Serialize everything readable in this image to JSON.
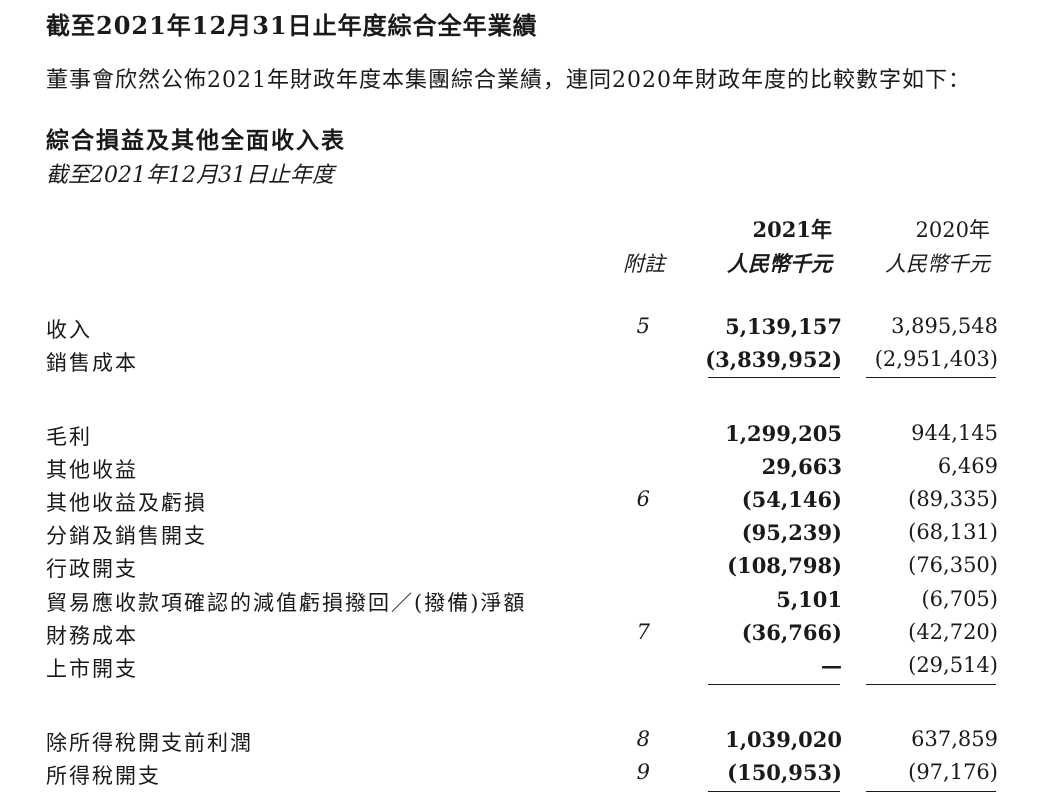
{
  "heading": "截至2021年12月31日止年度綜合全年業績",
  "intro": "董事會欣然公佈2021年財政年度本集團綜合業績，連同2020年財政年度的比較數字如下：",
  "statement": {
    "title": "綜合損益及其他全面收入表",
    "period": "截至2021年12月31日止年度"
  },
  "columns": {
    "note_label": "附註",
    "year_current": "2021年",
    "year_prior": "2020年",
    "unit_current": "人民幣千元",
    "unit_prior": "人民幣千元"
  },
  "rows": [
    {
      "label": "收入",
      "note": "5",
      "current": "5,139,157",
      "prior": "3,895,548"
    },
    {
      "label": "銷售成本",
      "note": "",
      "current": "(3,839,952)",
      "prior": "(2,951,403)"
    },
    {
      "label": "毛利",
      "note": "",
      "current": "1,299,205",
      "prior": "944,145"
    },
    {
      "label": "其他收益",
      "note": "",
      "current": "29,663",
      "prior": "6,469"
    },
    {
      "label": "其他收益及虧損",
      "note": "6",
      "current": "(54,146)",
      "prior": "(89,335)"
    },
    {
      "label": "分銷及銷售開支",
      "note": "",
      "current": "(95,239)",
      "prior": "(68,131)"
    },
    {
      "label": "行政開支",
      "note": "",
      "current": "(108,798)",
      "prior": "(76,350)"
    },
    {
      "label": "貿易應收款項確認的減值虧損撥回／(撥備)淨額",
      "note": "",
      "current": "5,101",
      "prior": "(6,705)"
    },
    {
      "label": "財務成本",
      "note": "7",
      "current": "(36,766)",
      "prior": "(42,720)"
    },
    {
      "label": "上市開支",
      "note": "",
      "current": "—",
      "prior": "(29,514)"
    },
    {
      "label": "除所得稅開支前利潤",
      "note": "8",
      "current": "1,039,020",
      "prior": "637,859"
    },
    {
      "label": "所得稅開支",
      "note": "9",
      "current": "(150,953)",
      "prior": "(97,176)"
    }
  ]
}
